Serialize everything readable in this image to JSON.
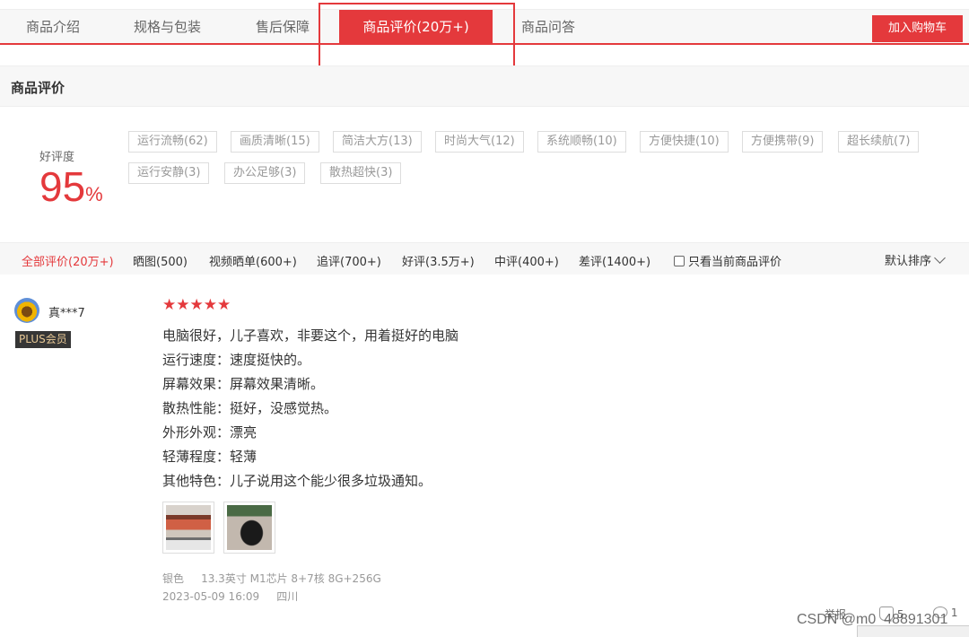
{
  "tabs": [
    {
      "label": "商品介绍"
    },
    {
      "label": "规格与包装"
    },
    {
      "label": "售后保障"
    },
    {
      "label": "商品评价(20万+)"
    },
    {
      "label": "商品问答"
    }
  ],
  "cart_button": "加入购物车",
  "section_title": "商品评价",
  "rating": {
    "label": "好评度",
    "value": "95",
    "unit": "%"
  },
  "tags": [
    "运行流畅(62)",
    "画质清晰(15)",
    "简洁大方(13)",
    "时尚大气(12)",
    "系统顺畅(10)",
    "方便快捷(10)",
    "方便携带(9)",
    "超长续航(7)",
    "运行安静(3)",
    "办公足够(3)",
    "散热超快(3)"
  ],
  "filters": [
    "全部评价(20万+)",
    "晒图(500)",
    "视频晒单(600+)",
    "追评(700+)",
    "好评(3.5万+)",
    "中评(400+)",
    "差评(1400+)"
  ],
  "only_current": "只看当前商品评价",
  "sort_label": "默认排序",
  "comment": {
    "username": "真***7",
    "badge": "PLUS会员",
    "stars": 5,
    "stars_text": "★★★★★",
    "lines": [
      "电脑很好，儿子喜欢，非要这个，用着挺好的电脑",
      "运行速度：速度挺快的。",
      "屏幕效果：屏幕效果清晰。",
      "散热性能：挺好，没感觉热。",
      "外形外观：漂亮",
      "轻薄程度：轻薄",
      "其他特色：儿子说用这个能少很多垃圾通知。"
    ],
    "spec_color": "银色",
    "spec_detail": "13.3英寸 M1芯片 8+7核 8G+256G",
    "date": "2023-05-09 16:09",
    "location": "四川",
    "report": "举报",
    "likes": "5",
    "replies": "1"
  },
  "watermark": "CSDN @m0_48891301",
  "colors": {
    "accent": "#e4393c",
    "plus_bg": "#363636",
    "plus_text": "#e7c896"
  }
}
